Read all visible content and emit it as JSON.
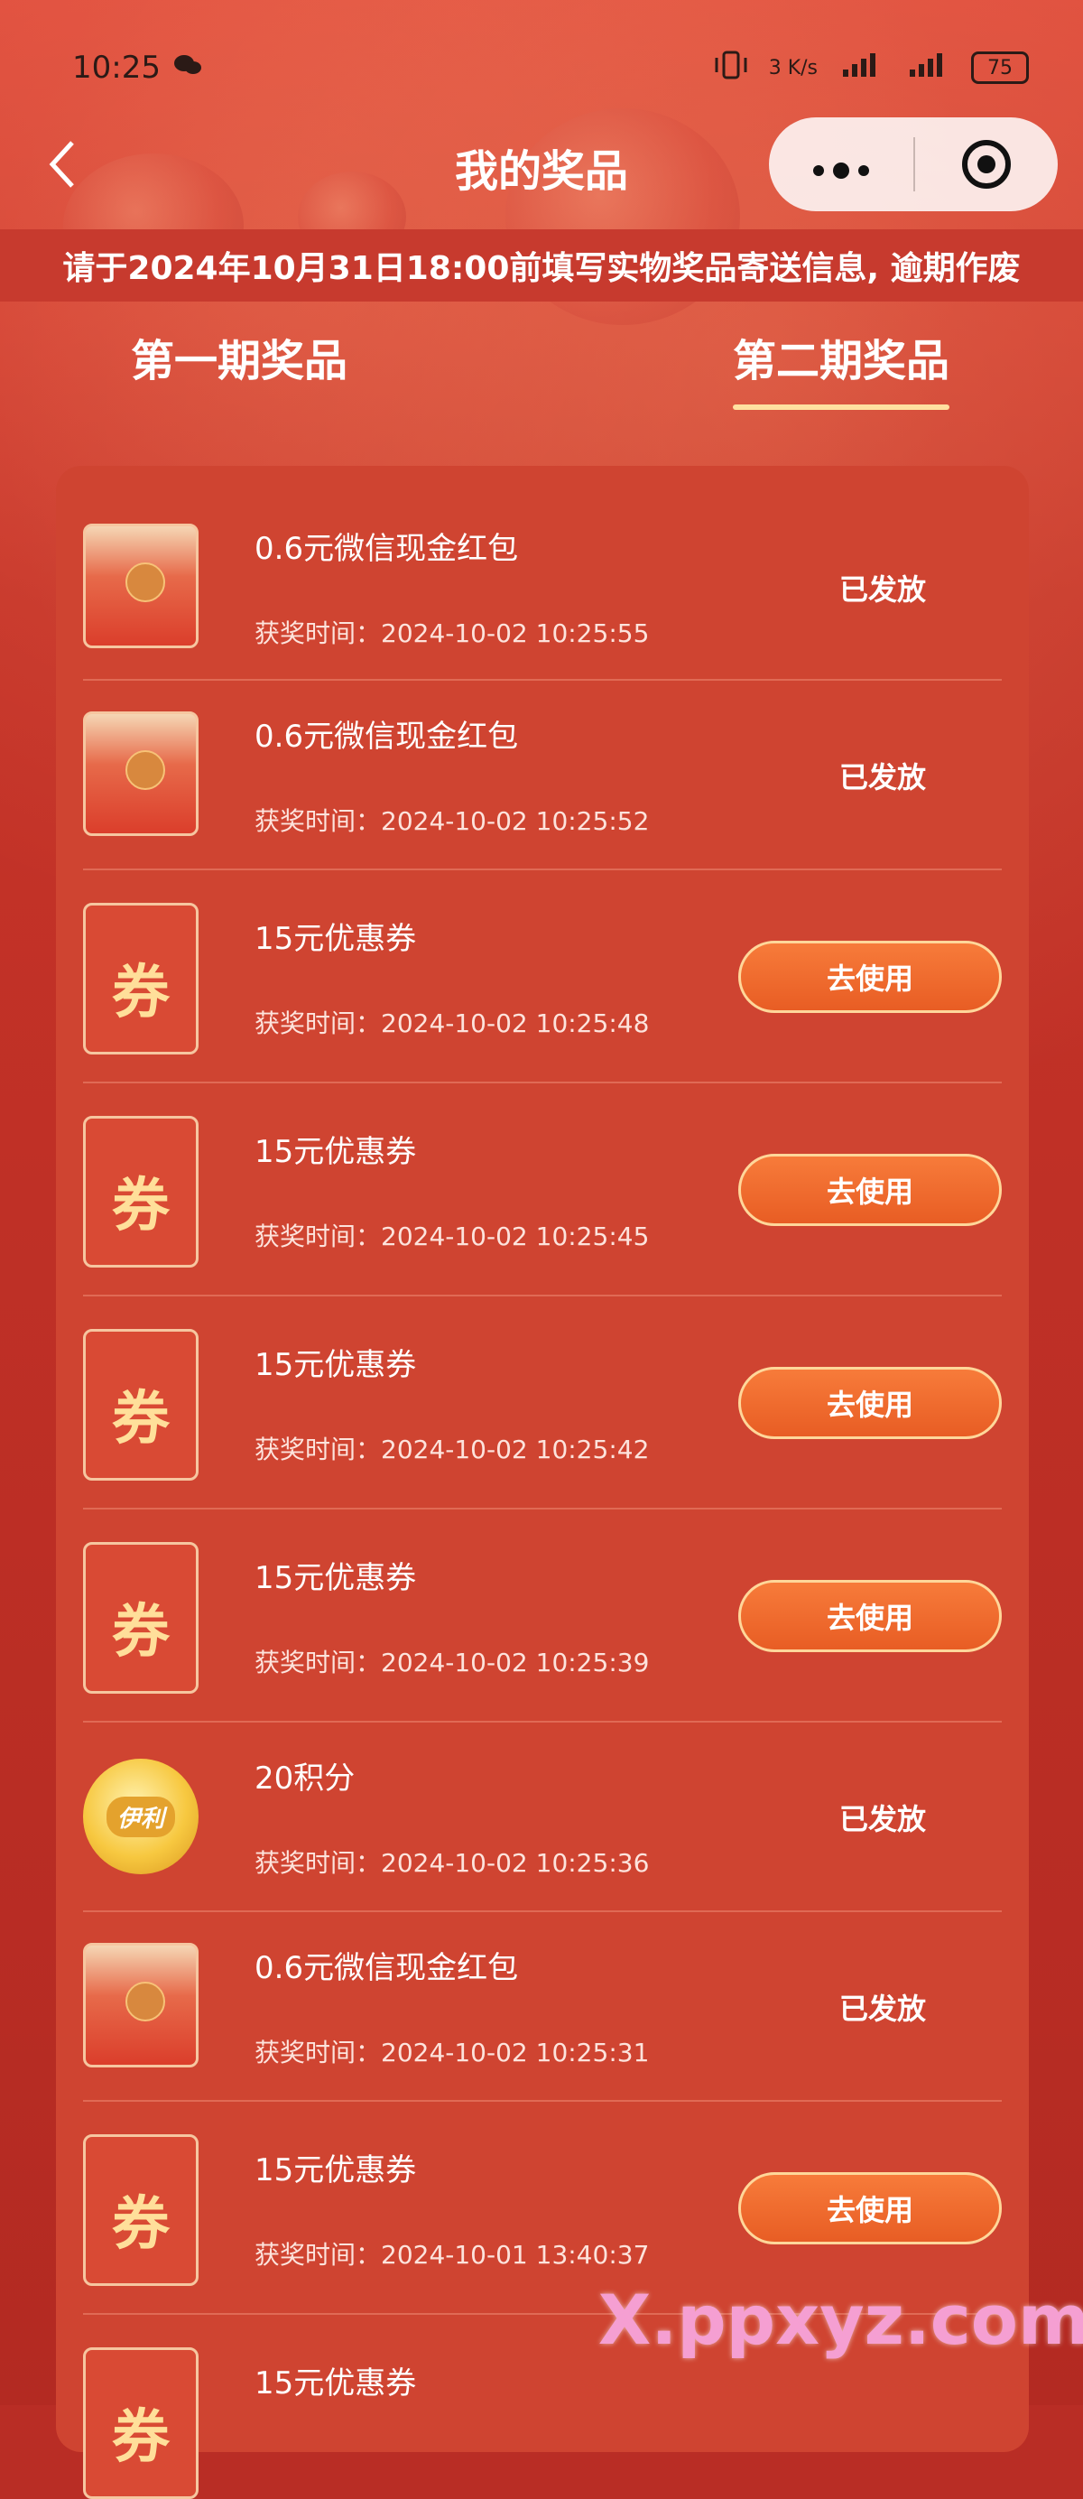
{
  "status_bar": {
    "time": "10:25",
    "speed": "3 K/s",
    "battery": "75",
    "icons": [
      "wechat-icon",
      "vibrate-icon",
      "signal-icon",
      "signal-icon"
    ]
  },
  "header": {
    "title": "我的奖品",
    "back_icon": "chevron-left-icon",
    "menu_icon": "more-dots-icon",
    "close_icon": "target-circle-icon"
  },
  "notice": "请于2024年10月31日18:00前填写实物奖品寄送信息, 逾期作废",
  "tabs": [
    {
      "label": "第一期奖品",
      "active": false
    },
    {
      "label": "第二期奖品",
      "active": true
    }
  ],
  "prizes": [
    {
      "type": "redpack",
      "name": "0.6元微信现金红包",
      "time": "获奖时间：2024-10-02 10:25:55",
      "status": "已发放",
      "action": ""
    },
    {
      "type": "redpack",
      "name": "0.6元微信现金红包",
      "time": "获奖时间：2024-10-02 10:25:52",
      "status": "已发放",
      "action": ""
    },
    {
      "type": "coupon",
      "name": "15元优惠券",
      "time": "获奖时间：2024-10-02 10:25:48",
      "status": "",
      "action": "去使用"
    },
    {
      "type": "coupon",
      "name": "15元优惠券",
      "time": "获奖时间：2024-10-02 10:25:45",
      "status": "",
      "action": "去使用"
    },
    {
      "type": "coupon",
      "name": "15元优惠券",
      "time": "获奖时间：2024-10-02 10:25:42",
      "status": "",
      "action": "去使用"
    },
    {
      "type": "coupon",
      "name": "15元优惠券",
      "time": "获奖时间：2024-10-02 10:25:39",
      "status": "",
      "action": "去使用"
    },
    {
      "type": "coin",
      "name": "20积分",
      "time": "获奖时间：2024-10-02 10:25:36",
      "status": "已发放",
      "action": ""
    },
    {
      "type": "redpack",
      "name": "0.6元微信现金红包",
      "time": "获奖时间：2024-10-02 10:25:31",
      "status": "已发放",
      "action": ""
    },
    {
      "type": "coupon",
      "name": "15元优惠券",
      "time": "获奖时间：2024-10-01 13:40:37",
      "status": "",
      "action": "去使用"
    },
    {
      "type": "coupon",
      "name": "15元优惠券",
      "time": "",
      "status": "",
      "action": ""
    }
  ],
  "coupon_glyph": "券",
  "coin_brand": "伊利",
  "watermark": "X.ppxyz.com"
}
